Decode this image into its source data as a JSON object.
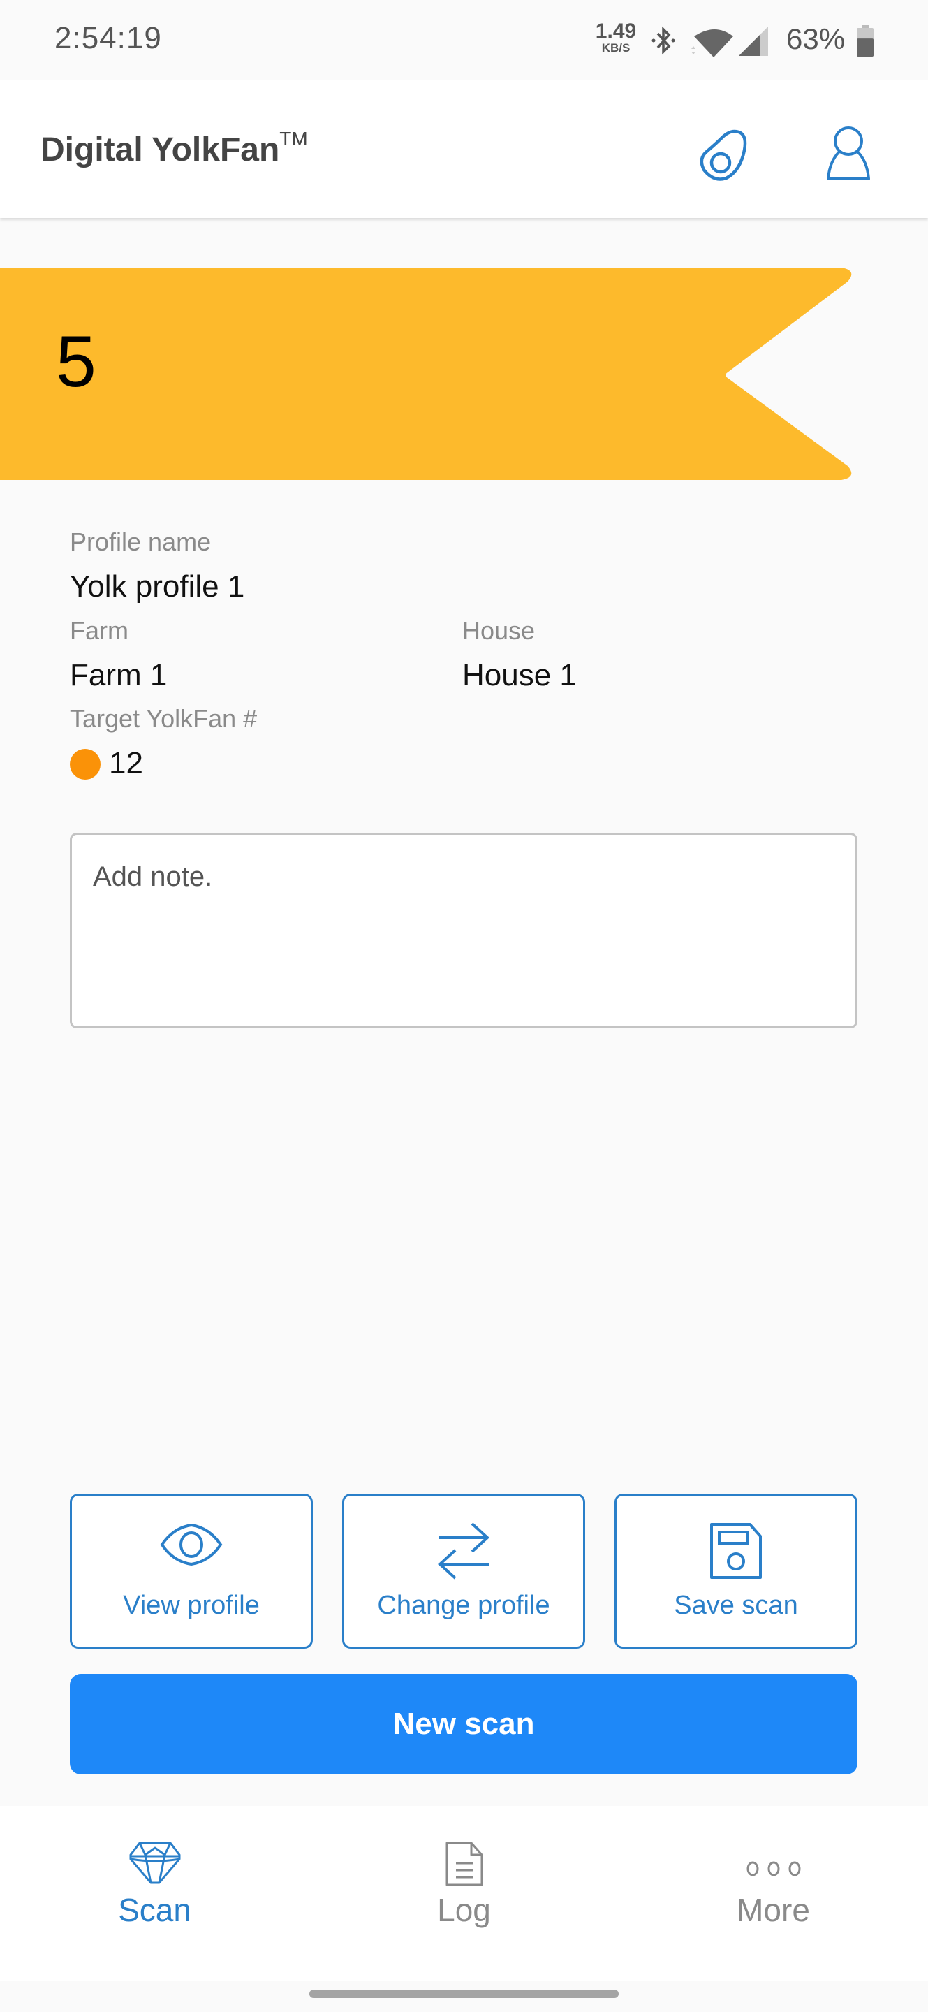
{
  "status_bar": {
    "time": "2:54:19",
    "net_speed_value": "1.49",
    "net_speed_unit": "KB/S",
    "battery_percent": "63%",
    "battery_level": 0.63,
    "icons": [
      "bluetooth-icon",
      "wifi-icon",
      "cellular-signal-icon",
      "battery-icon"
    ]
  },
  "header": {
    "title": "Digital YolkFan",
    "trademark": "TM",
    "actions": [
      {
        "name": "egg-icon"
      },
      {
        "name": "user-icon"
      }
    ]
  },
  "banner": {
    "value": "5",
    "color": "#FDBA2C"
  },
  "profile": {
    "profile_name_label": "Profile name",
    "profile_name": "Yolk profile 1",
    "farm_label": "Farm",
    "farm": "Farm 1",
    "house_label": "House",
    "house": "House 1",
    "target_label": "Target YolkFan #",
    "target_value": "12",
    "target_color": "#FA9208"
  },
  "note": {
    "placeholder": "Add note.",
    "value": ""
  },
  "actions": {
    "view_profile": "View profile",
    "change_profile": "Change profile",
    "save_scan": "Save scan",
    "new_scan": "New scan"
  },
  "bottom_nav": {
    "items": [
      {
        "label": "Scan",
        "icon": "diamond-icon",
        "active": true
      },
      {
        "label": "Log",
        "icon": "document-icon",
        "active": false
      },
      {
        "label": "More",
        "icon": "more-dots-icon",
        "active": false
      }
    ]
  },
  "colors": {
    "accent": "#2A7FC9",
    "primary_button": "#1E88F8",
    "inactive": "#8a8a8a"
  }
}
